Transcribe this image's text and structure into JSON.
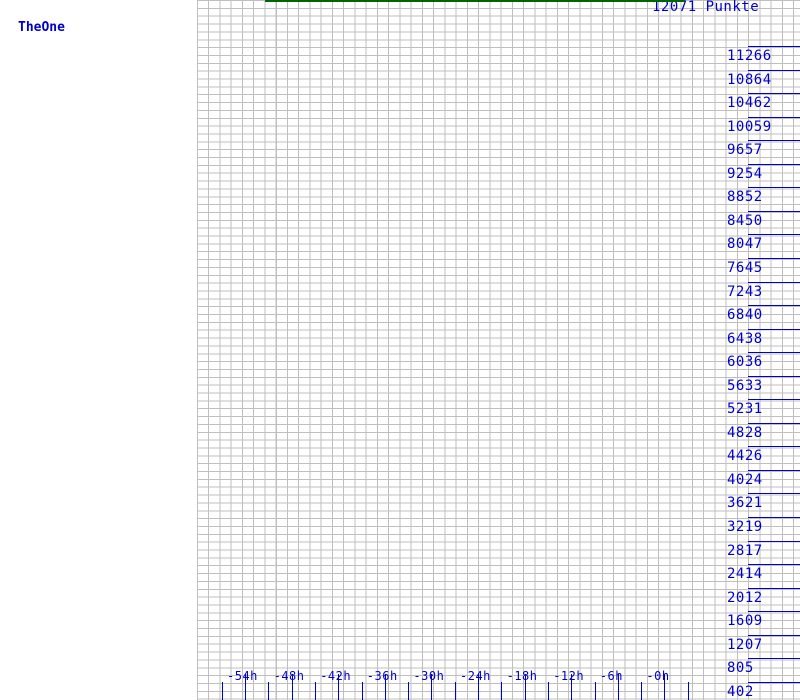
{
  "legend": {
    "label": "TheOne",
    "color": "#0000cc"
  },
  "header": {
    "title": "12071 Punkte"
  },
  "colors": {
    "axis": "#0000cc",
    "grid": "#bfbfbf",
    "series": "#006600",
    "background": "#ffffff"
  },
  "chart_data": {
    "type": "line",
    "title": "12071 Punkte",
    "xlabel": "",
    "ylabel": "Punkte",
    "grid": true,
    "legend_position": "left",
    "y_ticks": [
      11266,
      10864,
      10462,
      10059,
      9657,
      9254,
      8852,
      8450,
      8047,
      7645,
      7243,
      6840,
      6438,
      6036,
      5633,
      5231,
      4828,
      4426,
      4024,
      3621,
      3219,
      2817,
      2414,
      2012,
      1609,
      1207,
      805,
      402
    ],
    "ylim": [
      0,
      12071
    ],
    "x_ticks": [
      "-54h",
      "-48h",
      "-42h",
      "-36h",
      "-30h",
      "-24h",
      "-18h",
      "-12h",
      "-6h",
      "-0h"
    ],
    "xlim": [
      "-60h",
      "0h"
    ],
    "series": [
      {
        "name": "TheOne",
        "color": "#006600",
        "x": [
          "-53h",
          "-1h"
        ],
        "values": [
          12071,
          12071
        ]
      }
    ],
    "annotations": [
      "12071 Punkte"
    ]
  }
}
